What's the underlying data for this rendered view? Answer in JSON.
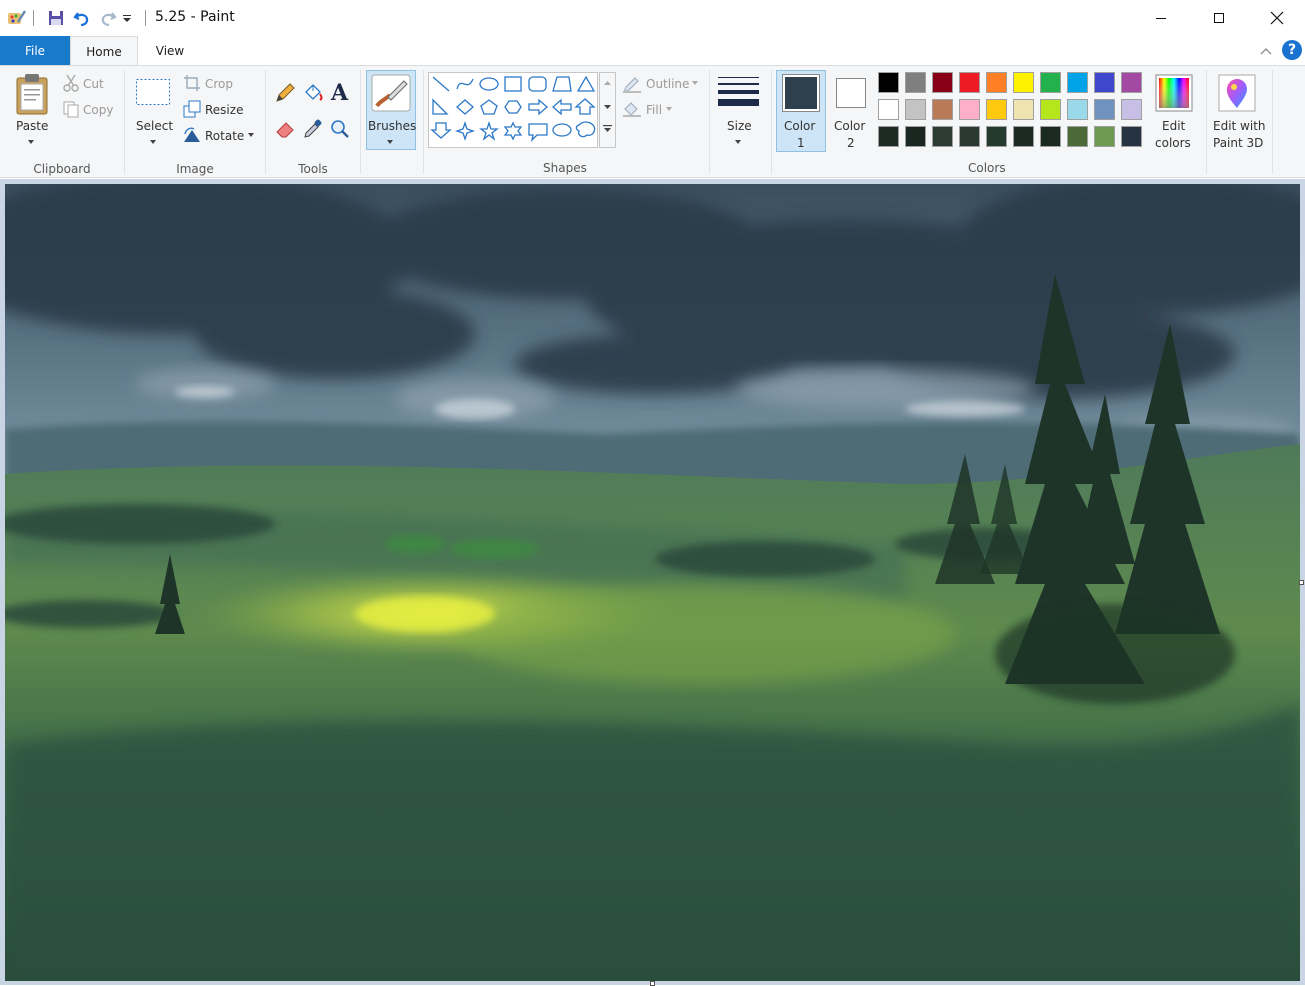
{
  "window": {
    "title": "5.25 - Paint"
  },
  "tabs": {
    "file": "File",
    "home": "Home",
    "view": "View"
  },
  "clipboard": {
    "paste": "Paste",
    "cut": "Cut",
    "copy": "Copy",
    "group": "Clipboard"
  },
  "image": {
    "select": "Select",
    "crop": "Crop",
    "resize": "Resize",
    "rotate": "Rotate",
    "group": "Image"
  },
  "tools": {
    "group": "Tools"
  },
  "brushes": {
    "label": "Brushes"
  },
  "shapes": {
    "outline": "Outline",
    "fill": "Fill",
    "group": "Shapes"
  },
  "size": {
    "label": "Size"
  },
  "colors": {
    "color1_line1": "Color",
    "color1_line2": "1",
    "color2_line1": "Color",
    "color2_line2": "2",
    "edit_line1": "Edit",
    "edit_line2": "colors",
    "group": "Colors",
    "color1_value": "#2e3f4d",
    "color2_value": "#ffffff",
    "palette": [
      "#000000",
      "#7f7f7f",
      "#880015",
      "#ed1c24",
      "#ff7f27",
      "#fff200",
      "#22b14c",
      "#00a2e8",
      "#3f48cc",
      "#a349a4",
      "#ffffff",
      "#c3c3c3",
      "#b97a57",
      "#ffaec9",
      "#ffc90e",
      "#efe4b0",
      "#b5e61d",
      "#99d9ea",
      "#7092be",
      "#c8bfe7",
      "#1e2a24",
      "#1a2620",
      "#2c3b33",
      "#2a3a32",
      "#243a2c",
      "#1c2a24",
      "#1a2a20",
      "#4a6a38",
      "#6e9a50",
      "#263442"
    ]
  },
  "paint3d": {
    "line1": "Edit with",
    "line2": "Paint 3D"
  }
}
